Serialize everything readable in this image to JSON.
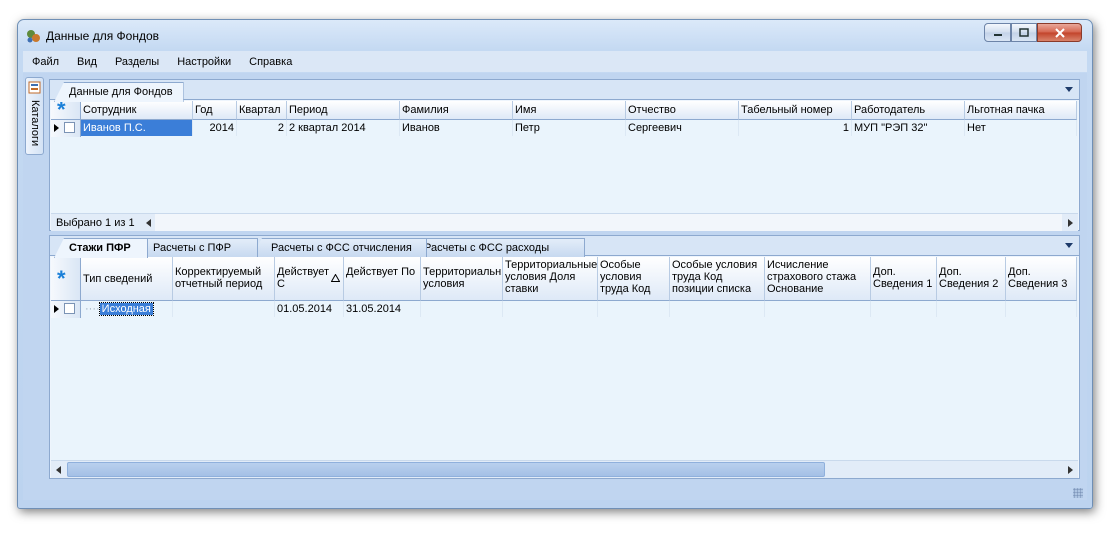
{
  "window": {
    "title": "Данные для Фондов"
  },
  "menu": [
    "Файл",
    "Вид",
    "Разделы",
    "Настройки",
    "Справка"
  ],
  "sidebar": {
    "label": "Каталоги"
  },
  "top_panel": {
    "tab": "Данные для Фондов",
    "columns": [
      "Сотрудник",
      "Год",
      "Квартал",
      "Период",
      "Фамилия",
      "Имя",
      "Отчество",
      "Табельный номер",
      "Работодатель",
      "Льготная пачка"
    ],
    "row": {
      "employee": "Иванов П.С.",
      "year": "2014",
      "quarter": "2",
      "period": "2 квартал 2014",
      "surname": "Иванов",
      "name": "Петр",
      "patronymic": "Сергеевич",
      "tab_number": "1",
      "employer": "МУП \"РЭП 32\"",
      "privileged": "Нет"
    },
    "status": "Выбрано 1 из 1"
  },
  "bottom_panel": {
    "tabs": [
      "Стажи ПФР",
      "Расчеты с ПФР",
      "Расчеты с ФСС отчисления",
      "Расчеты с ФСС расходы"
    ],
    "columns": [
      "Тип сведений",
      "Корректируемый отчетный период",
      "Действует С",
      "Действует По",
      "Территориальные условия",
      "Территориальные условия Доля ставки",
      "Особые условия труда Код",
      "Особые условия труда Код позиции списка",
      "Исчисление страхового стажа Основание",
      "Доп. Сведения 1",
      "Доп. Сведения 2",
      "Доп. Сведения 3"
    ],
    "row": {
      "type": "Исходная",
      "corrected": "",
      "from": "01.05.2014",
      "to": "31.05.2014"
    }
  }
}
